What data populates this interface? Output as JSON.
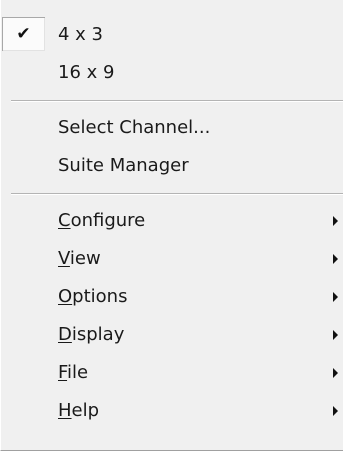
{
  "menu": {
    "aspect_items": [
      {
        "label": "4 x 3",
        "checked": true
      },
      {
        "label": "16 x 9",
        "checked": false
      }
    ],
    "channel_items": [
      {
        "label": "Select Channel..."
      },
      {
        "label": "Suite Manager"
      }
    ],
    "submenu_items": [
      {
        "mnemonic": "C",
        "rest": "onfigure",
        "has_submenu": true
      },
      {
        "mnemonic": "V",
        "rest": "iew",
        "has_submenu": true
      },
      {
        "mnemonic": "O",
        "rest": "ptions",
        "has_submenu": true
      },
      {
        "mnemonic": "D",
        "rest": "isplay",
        "has_submenu": true
      },
      {
        "mnemonic": "F",
        "rest": "ile",
        "has_submenu": true
      },
      {
        "mnemonic": "H",
        "rest": "elp",
        "has_submenu": true
      }
    ],
    "check_glyph": "✔"
  }
}
